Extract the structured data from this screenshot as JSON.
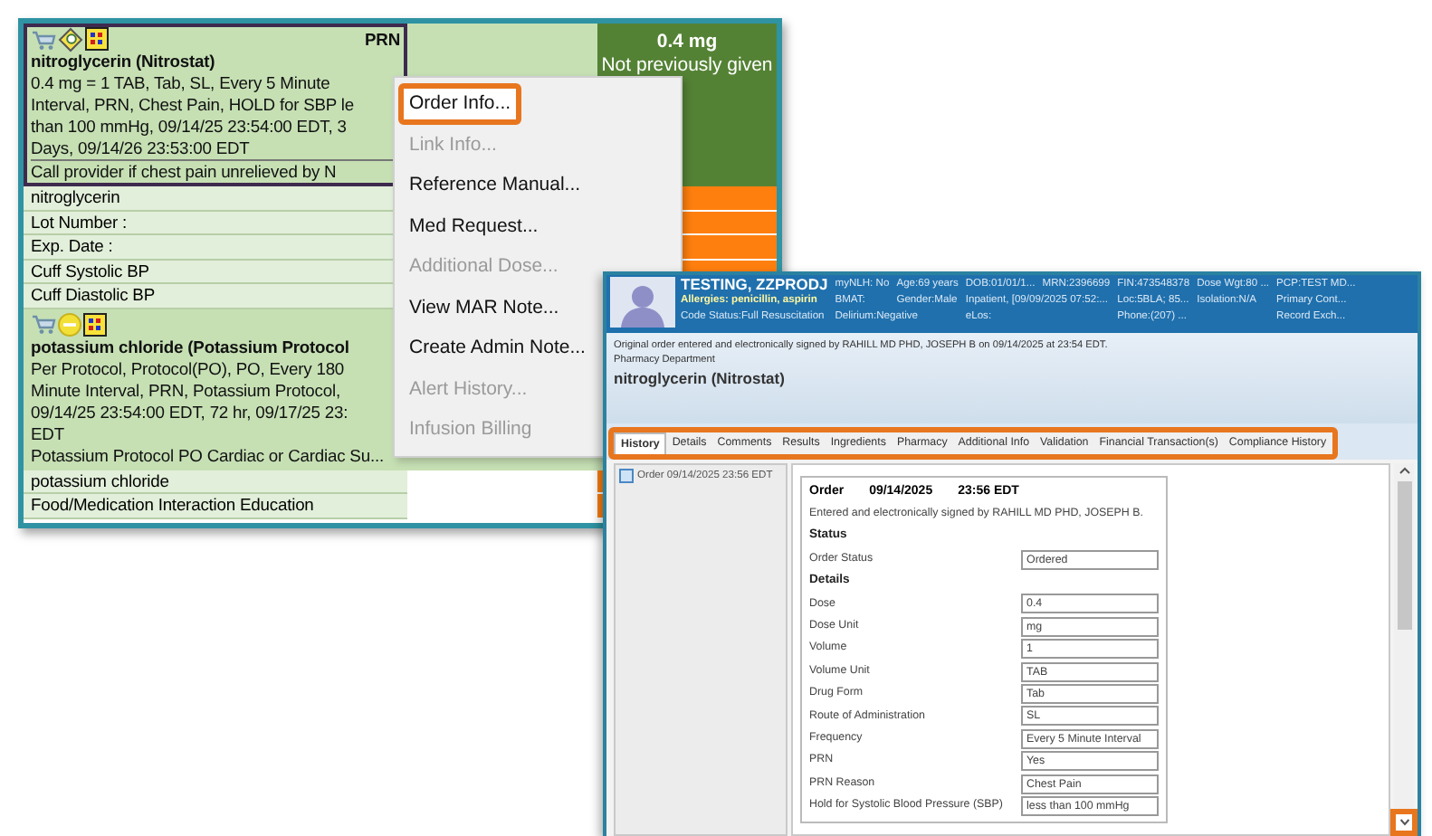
{
  "mar": {
    "orders": [
      {
        "selected": true,
        "icons": [
          {
            "kind": "cart"
          },
          {
            "kind": "diamond"
          },
          {
            "kind": "grid"
          }
        ],
        "prn": "PRN",
        "title": "nitroglycerin (Nitrostat)",
        "details": [
          "0.4 mg = 1 TAB, Tab, SL, Every 5 Minute",
          "Interval, PRN, Chest Pain, HOLD for SBP le",
          "than 100 mmHg, 09/14/25 23:54:00 EDT, 3",
          "Days, 09/14/26 23:53:00 EDT"
        ],
        "comment": "Call provider if chest pain unrelieved by N",
        "dose": "0.4 mg",
        "dose_status": "Not previously given",
        "tasks": [
          "nitroglycerin",
          "Lot Number :",
          "Exp. Date :",
          "Cuff Systolic BP",
          "Cuff Diastolic BP"
        ]
      },
      {
        "selected": false,
        "icons": [
          {
            "kind": "cart"
          },
          {
            "kind": "minus-circle"
          },
          {
            "kind": "grid"
          }
        ],
        "title": "potassium chloride (Potassium Protocol",
        "details": [
          "Per Protocol, Protocol(PO), PO, Every 180",
          "Minute Interval, PRN, Potassium Protocol,",
          "09/14/25 23:54:00 EDT, 72 hr, 09/17/25 23:",
          "EDT"
        ],
        "comment": "Potassium Protocol PO Cardiac or Cardiac Su...",
        "tasks": [
          "potassium chloride",
          "Food/Medication Interaction Education"
        ]
      }
    ]
  },
  "context_menu": [
    {
      "label": "Order Info...",
      "disabled": false,
      "highlighted": true
    },
    {
      "label": "Link Info...",
      "disabled": true,
      "highlighted": false
    },
    {
      "label": "Reference Manual...",
      "disabled": false,
      "highlighted": false
    },
    {
      "label": "Med Request...",
      "disabled": false,
      "highlighted": false
    },
    {
      "label": "Additional Dose...",
      "disabled": true,
      "highlighted": false
    },
    {
      "label": "View MAR Note...",
      "disabled": false,
      "highlighted": false
    },
    {
      "label": "Create Admin Note...",
      "disabled": false,
      "highlighted": false
    },
    {
      "label": "Alert History...",
      "disabled": true,
      "highlighted": false
    },
    {
      "label": "Infusion Billing",
      "disabled": true,
      "highlighted": false
    }
  ],
  "order_window": {
    "banner_columns": [
      [
        "TESTING, ZZPRODJ",
        "Allergies: penicillin, aspirin",
        "Code Status:Full Resuscitation"
      ],
      [
        "myNLH: No",
        "BMAT:",
        "Delirium:Negative"
      ],
      [
        "Age:69 years",
        "Gender:Male"
      ],
      [
        "DOB:01/01/1...",
        "Inpatient, [09/09/2025 07:52:...",
        "eLos:"
      ],
      [
        "MRN:2396699"
      ],
      [
        "FIN:473548378",
        "Loc:5BLA; 85...",
        "Phone:(207) ..."
      ],
      [
        "Dose Wgt:80 ...",
        "Isolation:N/A"
      ],
      [
        "PCP:TEST MD...",
        "Primary Cont...",
        "Record Exch..."
      ]
    ],
    "signature": "Original order entered and electronically signed by RAHILL MD PHD, JOSEPH B on 09/14/2025 at 23:54 EDT.",
    "department": "Pharmacy Department",
    "title": "nitroglycerin (Nitrostat)",
    "tabs_highlighted": true,
    "tabs": [
      {
        "label": "History",
        "selected": true
      },
      {
        "label": "Details",
        "selected": false
      },
      {
        "label": "Comments",
        "selected": false
      },
      {
        "label": "Results",
        "selected": false
      },
      {
        "label": "Ingredients",
        "selected": false
      },
      {
        "label": "Pharmacy",
        "selected": false
      },
      {
        "label": "Additional Info",
        "selected": false
      },
      {
        "label": "Validation",
        "selected": false
      },
      {
        "label": "Financial Transaction(s)",
        "selected": false
      },
      {
        "label": "Compliance History",
        "selected": false
      }
    ],
    "history_items": [
      "Order 09/14/2025 23:56 EDT"
    ],
    "detail": {
      "header": [
        "Order",
        "09/14/2025",
        "23:56 EDT"
      ],
      "signed": "Entered and electronically signed by RAHILL MD PHD, JOSEPH B.",
      "sections": [
        {
          "heading": "Status",
          "fields": [
            {
              "label": "Order Status",
              "value": "Ordered"
            }
          ]
        },
        {
          "heading": "Details",
          "fields": [
            {
              "label": "Dose",
              "value": "0.4"
            },
            {
              "label": "Dose Unit",
              "value": "mg"
            },
            {
              "label": "Volume",
              "value": "1"
            },
            {
              "label": "Volume Unit",
              "value": "TAB"
            },
            {
              "label": "Drug Form",
              "value": "Tab"
            },
            {
              "label": "Route of Administration",
              "value": "SL"
            },
            {
              "label": "Frequency",
              "value": "Every 5 Minute Interval"
            },
            {
              "label": "PRN",
              "value": "Yes"
            },
            {
              "label": "PRN Reason",
              "value": "Chest Pain"
            },
            {
              "label": "Hold for Systolic Blood Pressure (SBP)",
              "value": "less than 100 mmHg"
            }
          ]
        }
      ]
    },
    "scroll_down_highlighted": true
  }
}
